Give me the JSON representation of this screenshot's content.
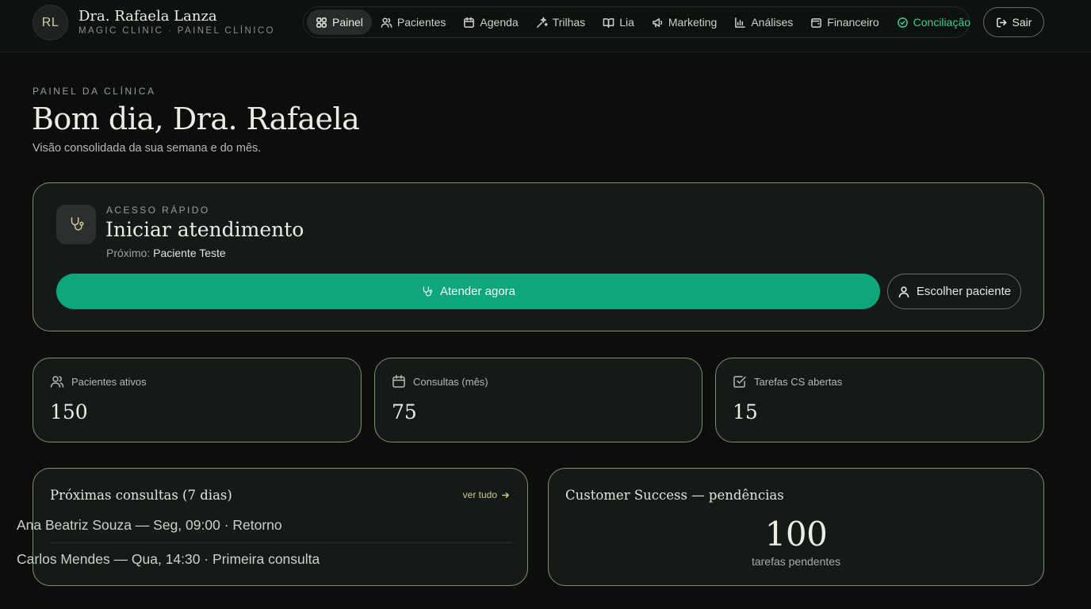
{
  "user": {
    "initials": "RL",
    "name": "Dra. Rafaela Lanza",
    "subtitle": "MAGIC CLINIC · PAINEL CLÍNICO"
  },
  "nav": {
    "items": [
      {
        "label": "Painel",
        "icon": "grid-icon",
        "active": true
      },
      {
        "label": "Pacientes",
        "icon": "users-icon"
      },
      {
        "label": "Agenda",
        "icon": "calendar-icon"
      },
      {
        "label": "Trilhas",
        "icon": "sparkle-icon"
      },
      {
        "label": "Lia",
        "icon": "book-icon"
      },
      {
        "label": "Marketing",
        "icon": "megaphone-icon"
      },
      {
        "label": "Análises",
        "icon": "bar-chart-icon"
      },
      {
        "label": "Financeiro",
        "icon": "wallet-icon"
      },
      {
        "label": "Conciliação",
        "icon": "check-circle-icon",
        "accent": true
      }
    ],
    "logout_label": "Sair"
  },
  "header": {
    "eyebrow": "PAINEL DA CLÍNICA",
    "greeting": "Bom dia, Dra. Rafaela",
    "subtitle": "Visão consolidada da sua semana e do mês."
  },
  "quick_access": {
    "eyebrow": "ACESSO RÁPIDO",
    "title": "Iniciar atendimento",
    "next_prefix": "Próximo:",
    "next_patient": "Paciente Teste",
    "primary_label": "Atender agora",
    "secondary_label": "Escolher paciente"
  },
  "stats": [
    {
      "label": "Pacientes ativos",
      "value": "150",
      "icon": "users-icon"
    },
    {
      "label": "Consultas (mês)",
      "value": "75",
      "icon": "calendar-icon"
    },
    {
      "label": "Tarefas CS abertas",
      "value": "15",
      "icon": "checkbox-icon"
    }
  ],
  "upcoming": {
    "title": "Próximas consultas (7 dias)",
    "see_all": "ver tudo",
    "items": [
      "Ana Beatriz Souza — Seg, 09:00 · Retorno",
      "Carlos Mendes — Qua, 14:30 · Primeira consulta"
    ]
  },
  "customer_success": {
    "title": "Customer Success — pendências",
    "count": "100",
    "caption": "tarefas pendentes"
  },
  "colors": {
    "background": "#0b0e0d",
    "card": "#131a18",
    "card_border": "#8e8a68",
    "primary": "#0ea67b",
    "accent_green": "#3ccf8e",
    "gold": "#d8c99a"
  }
}
